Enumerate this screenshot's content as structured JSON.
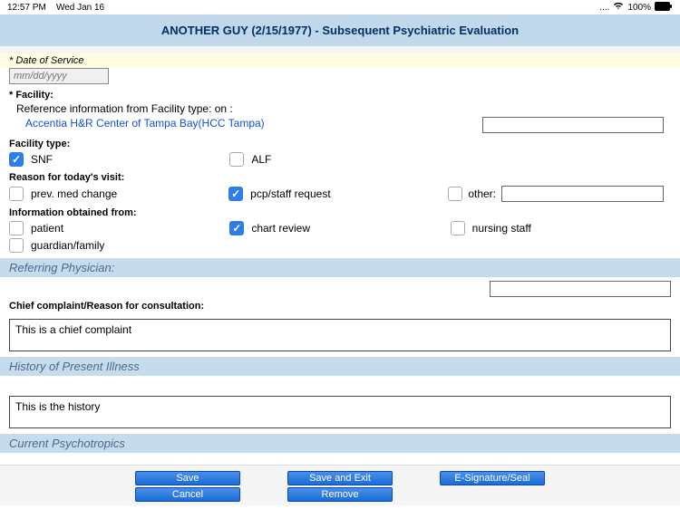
{
  "status": {
    "time": "12:57 PM",
    "date": "Wed Jan 16",
    "signal": "....",
    "wifi": "wifi",
    "battery_pct": "100%"
  },
  "header": {
    "title": "ANOTHER GUY (2/15/1977) - Subsequent Psychiatric Evaluation"
  },
  "dos": {
    "label": "* Date of Service",
    "placeholder": "mm/dd/yyyy"
  },
  "facility": {
    "label": "* Facility:",
    "ref_text": "Reference information from Facility type: on :",
    "link": "Accentia H&R Center of Tampa Bay(HCC Tampa)"
  },
  "ftype": {
    "label": "Facility type:",
    "opts": [
      {
        "label": "SNF",
        "checked": true
      },
      {
        "label": "ALF",
        "checked": false
      }
    ]
  },
  "reason": {
    "label": "Reason for today's visit:",
    "opts": [
      {
        "label": "prev. med change",
        "checked": false
      },
      {
        "label": "pcp/staff request",
        "checked": true
      },
      {
        "label": "other:",
        "checked": false
      }
    ]
  },
  "info": {
    "label": "Information obtained from:",
    "row1": [
      {
        "label": "patient",
        "checked": false
      },
      {
        "label": "chart review",
        "checked": true
      },
      {
        "label": "nursing staff",
        "checked": false
      }
    ],
    "row2": [
      {
        "label": "guardian/family",
        "checked": false
      }
    ]
  },
  "sections": {
    "referring": "Referring Physician:",
    "chief_label": "Chief complaint/Reason for consultation:",
    "chief_text": "This is a chief complaint",
    "hpi": "History of Present Illness",
    "hpi_text": "This is the history",
    "psychotropics": "Current Psychotropics"
  },
  "buttons": {
    "save": "Save",
    "save_exit": "Save and Exit",
    "esig": "E-Signature/Seal",
    "cancel": "Cancel",
    "remove": "Remove"
  }
}
